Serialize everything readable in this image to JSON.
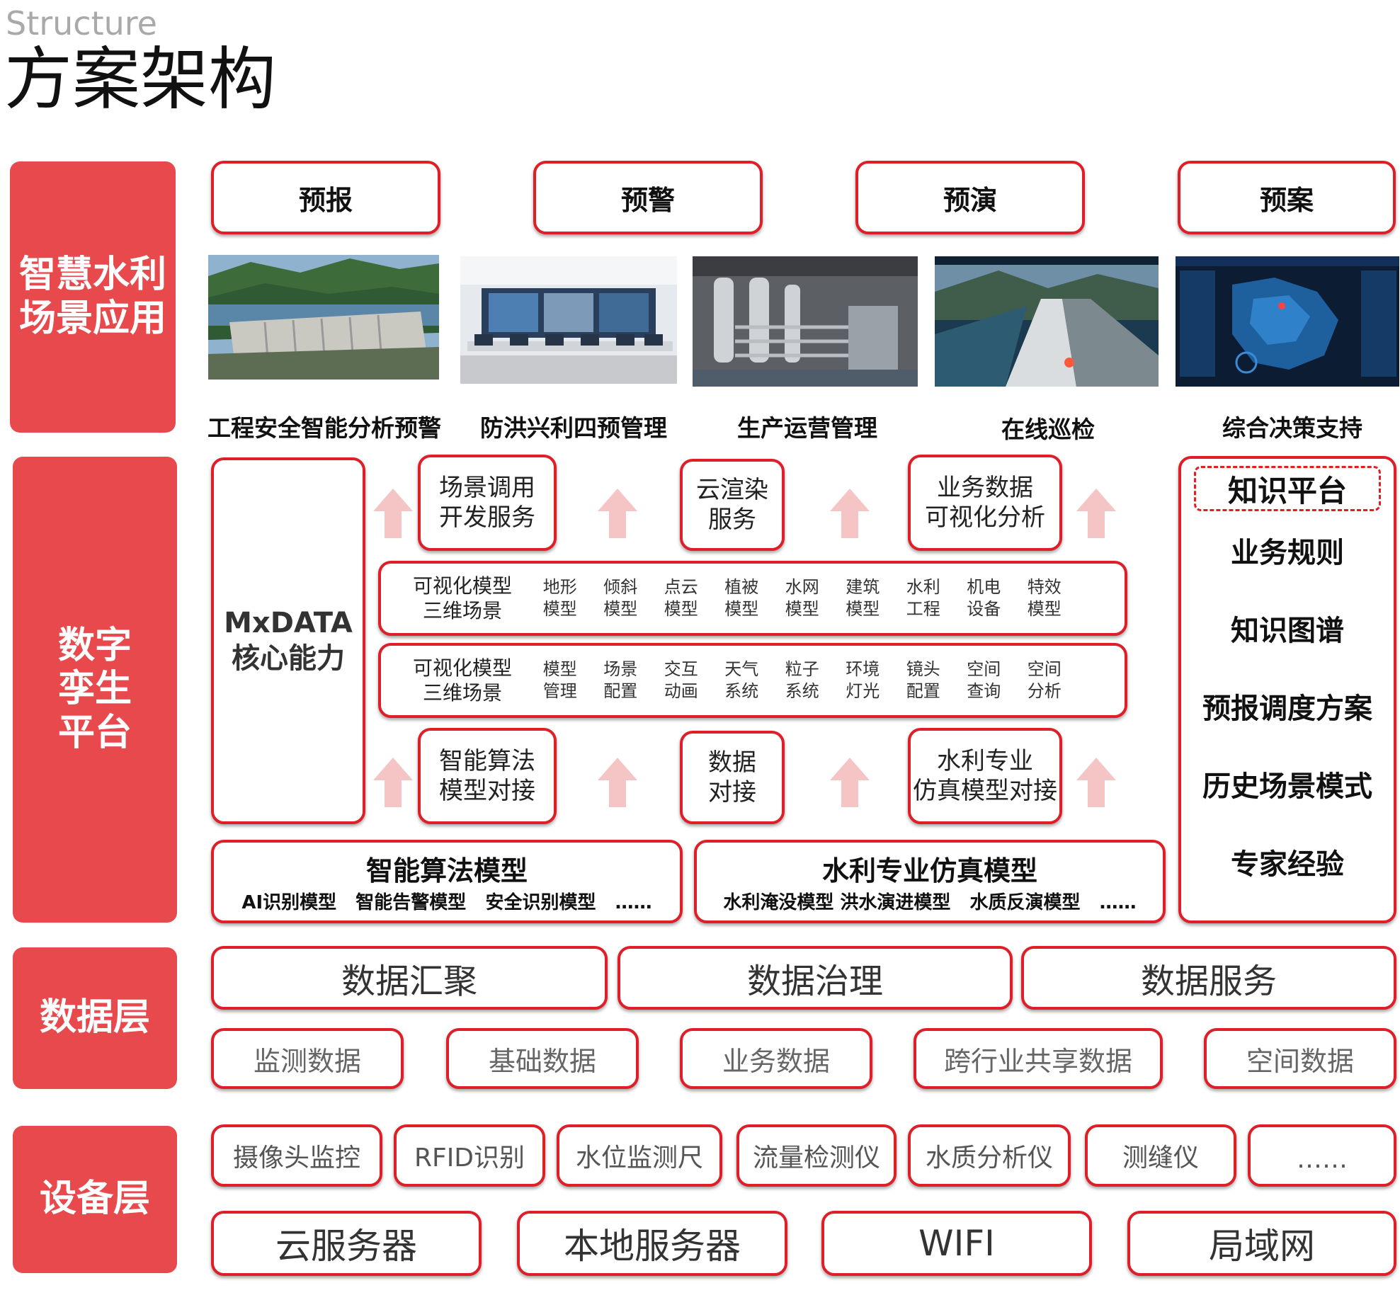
{
  "header": {
    "en": "Structure",
    "cn": "方案架构"
  },
  "bands": {
    "scene": "智慧水利\n场景应用",
    "twin": "数字\n孪生\n平台",
    "data": "数据层",
    "device": "设备层"
  },
  "scene_tabs": [
    "预报",
    "预警",
    "预演",
    "预案"
  ],
  "scene_photos": [
    {
      "caption": "工程安全智能分析预警",
      "icon": "dam-photo"
    },
    {
      "caption": "防洪兴利四预管理",
      "icon": "control-room-photo"
    },
    {
      "caption": "生产运营管理",
      "icon": "plant-photo"
    },
    {
      "caption": "在线巡检",
      "icon": "inspection-3d-photo"
    },
    {
      "caption": "综合决策支持",
      "icon": "dashboard-map-photo"
    }
  ],
  "core": {
    "label": "MxDATA\n核心能力"
  },
  "services_top": [
    "场景调用\n开发服务",
    "云渲染\n服务",
    "业务数据\n可视化分析"
  ],
  "services_bottom": [
    "智能算法\n模型对接",
    "数据\n对接",
    "水利专业\n仿真模型对接"
  ],
  "model_row1": {
    "head": "可视化模型\n三维场景",
    "cells": [
      "地形\n模型",
      "倾斜\n模型",
      "点云\n模型",
      "植被\n模型",
      "水网\n模型",
      "建筑\n模型",
      "水利\n工程",
      "机电\n设备",
      "特效\n模型"
    ]
  },
  "model_row2": {
    "head": "可视化模型\n三维场景",
    "cells": [
      "模型\n管理",
      "场景\n配置",
      "交互\n动画",
      "天气\n系统",
      "粒子\n系统",
      "环境\n灯光",
      "镜头\n配置",
      "空间\n查询",
      "空间\n分析"
    ]
  },
  "ai_models": {
    "title": "智能算法模型",
    "items": "AI识别模型   智能告警模型   安全识别模型   ……"
  },
  "sim_models": {
    "title": "水利专业仿真模型",
    "items": "水利淹没模型 洪水演进模型   水质反演模型   ……"
  },
  "knowledge": {
    "head": "知识平台",
    "items": [
      "业务规则",
      "知识图谱",
      "预报调度方案",
      "历史场景模式",
      "专家经验"
    ]
  },
  "data_main": [
    "数据汇聚",
    "数据治理",
    "数据服务"
  ],
  "data_sub": [
    "监测数据",
    "基础数据",
    "业务数据",
    "跨行业共享数据",
    "空间数据"
  ],
  "device_sub": [
    "摄像头监控",
    "RFID识别",
    "水位监测尺",
    "流量检测仪",
    "水质分析仪",
    "测缝仪",
    "……"
  ],
  "device_main": [
    "云服务器",
    "本地服务器",
    "WIFI",
    "局域网"
  ],
  "colors": {
    "accent": "#e8494c",
    "border": "#e01e27",
    "arrow": "#f5c5c5"
  }
}
